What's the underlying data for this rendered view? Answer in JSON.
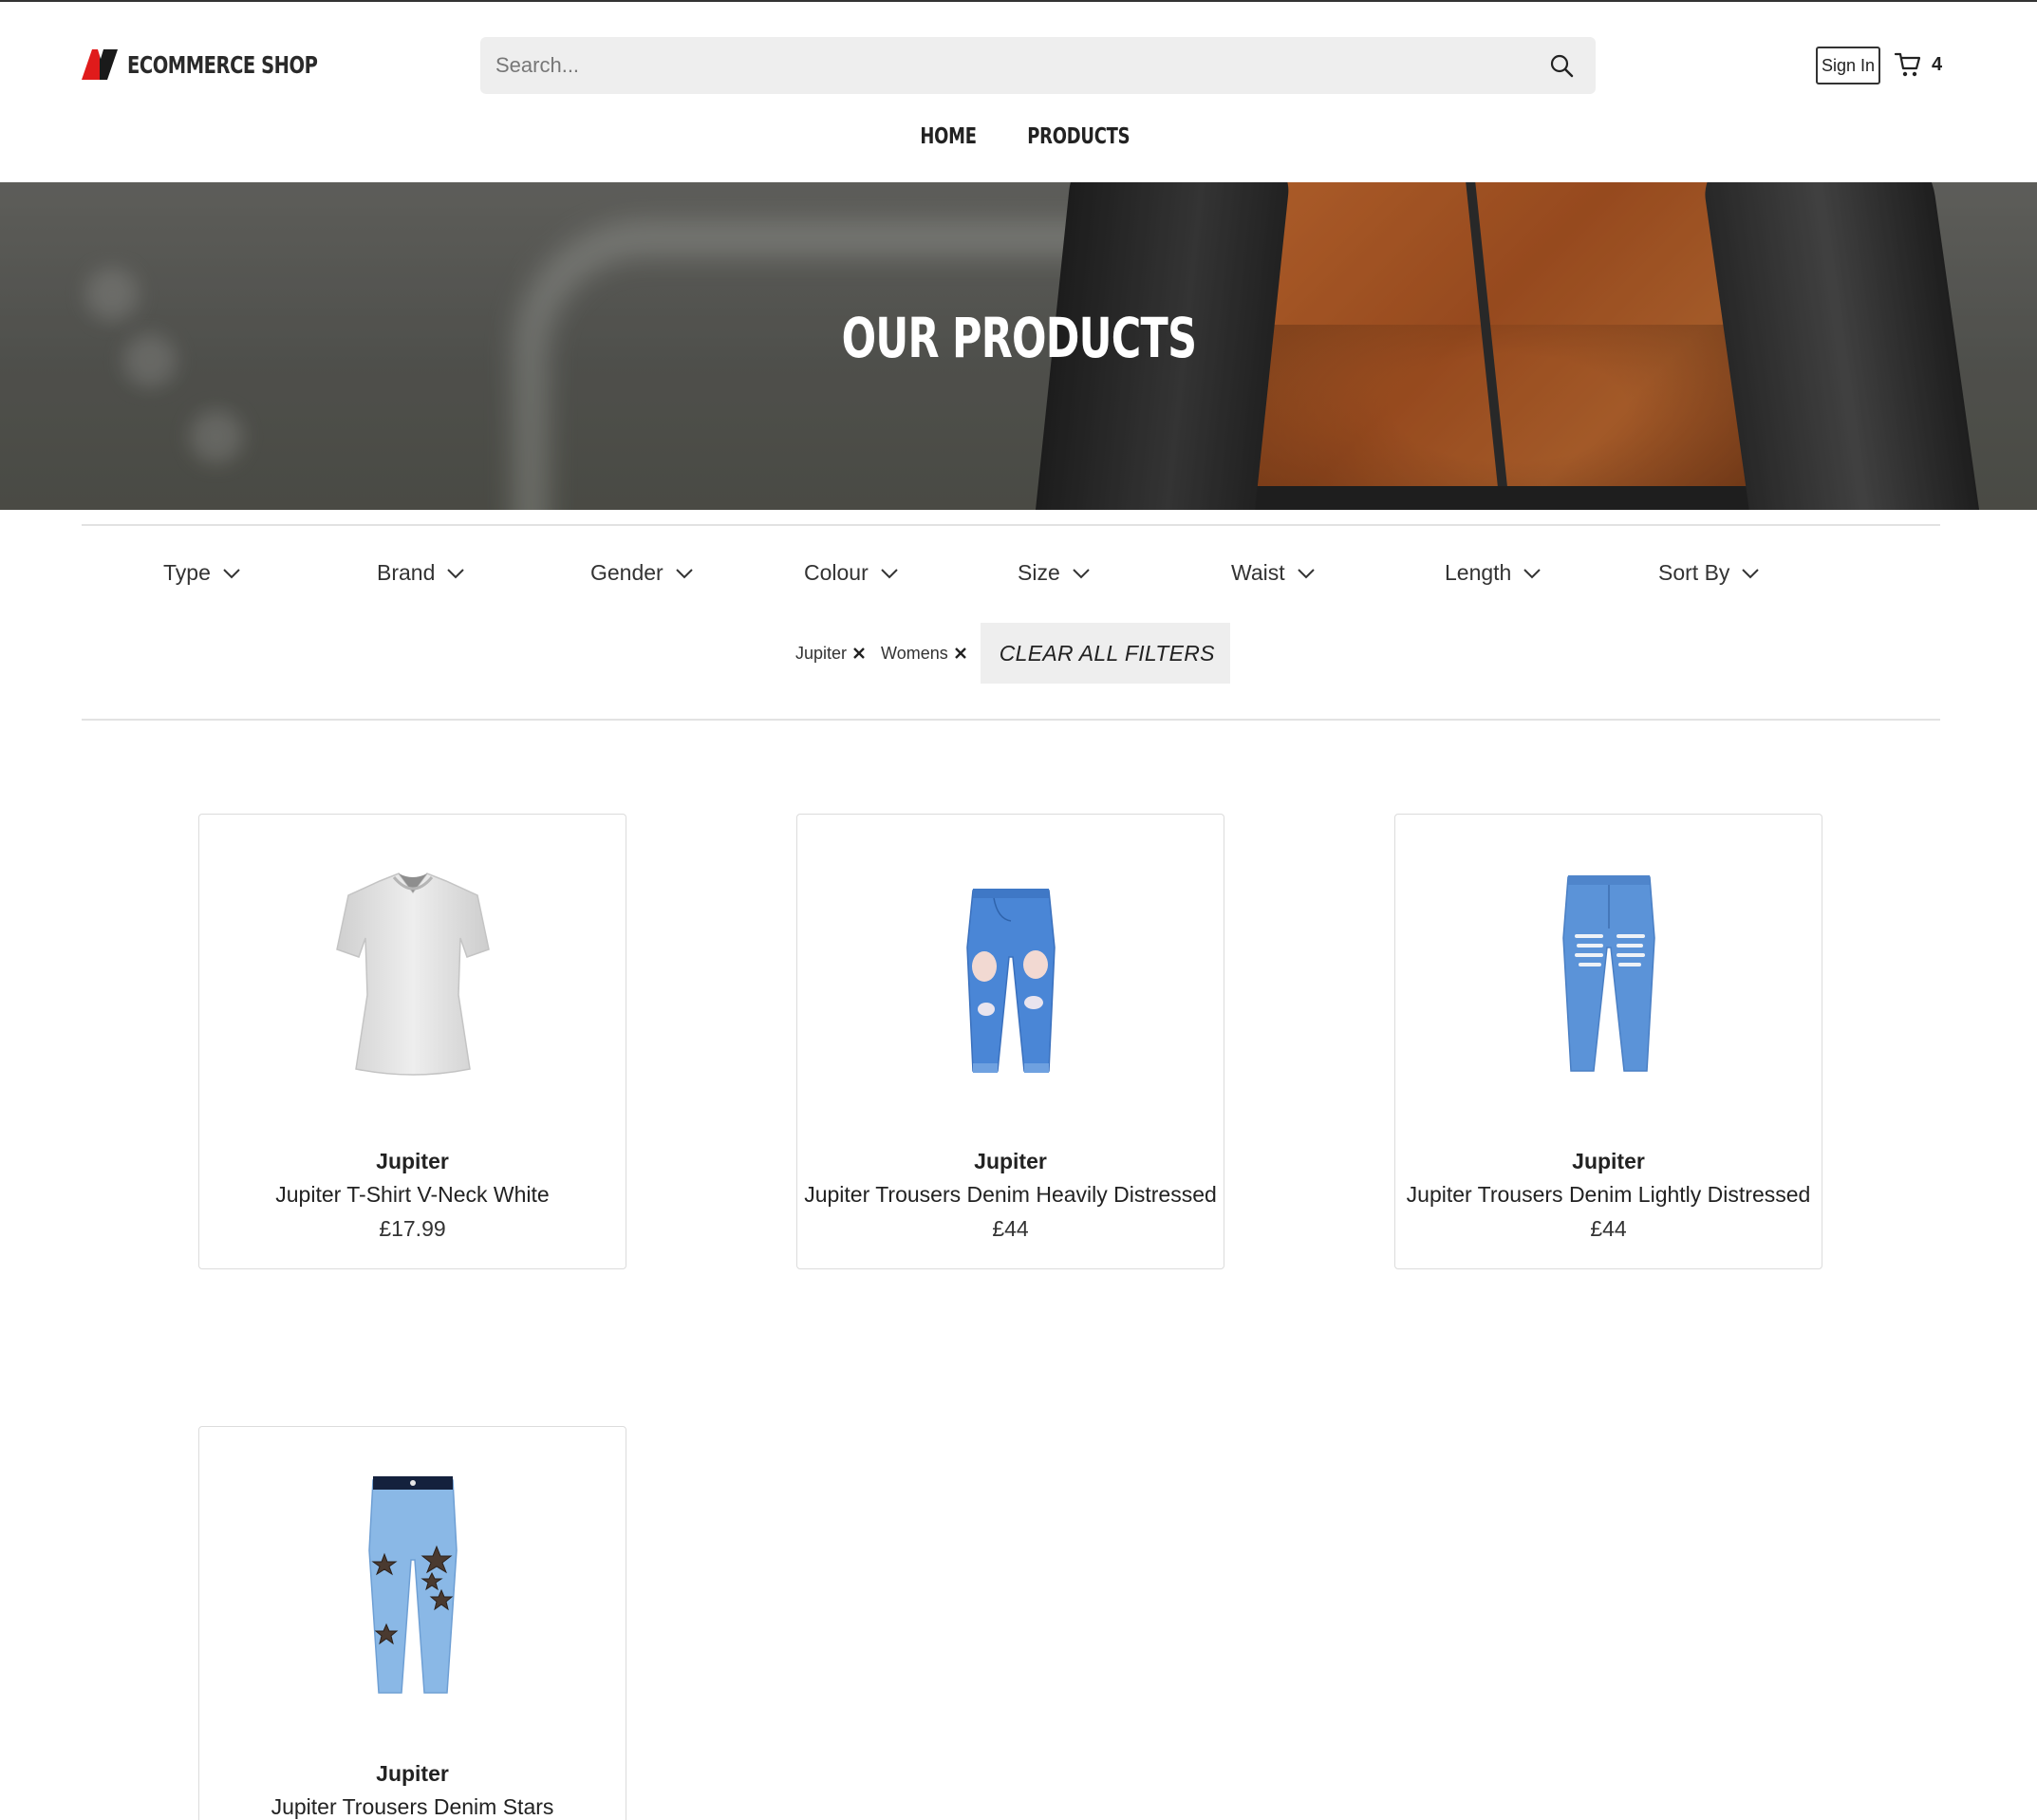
{
  "header": {
    "brand_name": "ECOMMERCE SHOP",
    "search_placeholder": "Search...",
    "search_value": "",
    "signin_label": "Sign In",
    "cart_count": "4"
  },
  "nav": {
    "items": [
      {
        "label": "HOME"
      },
      {
        "label": "PRODUCTS"
      }
    ]
  },
  "hero": {
    "title": "OUR PRODUCTS"
  },
  "filters": {
    "dropdowns": [
      {
        "label": "Type"
      },
      {
        "label": "Brand"
      },
      {
        "label": "Gender"
      },
      {
        "label": "Colour"
      },
      {
        "label": "Size"
      },
      {
        "label": "Waist"
      },
      {
        "label": "Length"
      },
      {
        "label": "Sort By"
      }
    ],
    "active": [
      {
        "label": "Jupiter"
      },
      {
        "label": "Womens"
      }
    ],
    "clear_label": "CLEAR ALL FILTERS"
  },
  "products": [
    {
      "brand": "Jupiter",
      "name": "Jupiter T-Shirt V-Neck White",
      "price": "£17.99",
      "image_icon": "white-vneck-tshirt"
    },
    {
      "brand": "Jupiter",
      "name": "Jupiter Trousers Denim Heavily Distressed",
      "price": "£44",
      "image_icon": "heavily-distressed-jeans"
    },
    {
      "brand": "Jupiter",
      "name": "Jupiter Trousers Denim Lightly Distressed",
      "price": "£44",
      "image_icon": "lightly-distressed-jeans"
    },
    {
      "brand": "Jupiter",
      "name": "Jupiter Trousers Denim Stars",
      "price": "",
      "image_icon": "star-print-jeans"
    }
  ],
  "colors": {
    "logo_red": "#e01b1b",
    "logo_dark": "#1a1a1a",
    "search_bg": "#eeeeee",
    "clear_bg": "#eeeeee",
    "denim_blue": "#4a86d6",
    "denim_light": "#8ab8e6"
  }
}
